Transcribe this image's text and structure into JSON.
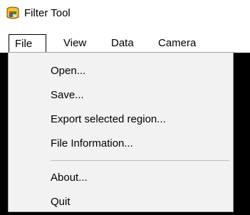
{
  "window": {
    "title": "Filter Tool",
    "icon": "filter-tool-app-icon"
  },
  "menubar": {
    "items": [
      {
        "label": "File",
        "active": true
      },
      {
        "label": "View"
      },
      {
        "label": "Data"
      },
      {
        "label": "Camera"
      }
    ]
  },
  "file_menu": {
    "items": [
      {
        "label": "Open..."
      },
      {
        "label": "Save..."
      },
      {
        "label": "Export selected region..."
      },
      {
        "label": "File Information..."
      },
      {
        "label": "About..."
      },
      {
        "label": "Quit"
      }
    ]
  },
  "colors": {
    "client_background": "#000000",
    "menu_background": "#f2f2f2",
    "menu_border": "#a0a0a0",
    "separator": "#bdbdbd"
  }
}
